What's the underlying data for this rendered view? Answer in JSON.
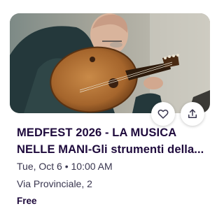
{
  "event": {
    "title_line1": "MEDFEST 2026 - LA MUSICA",
    "title_line2": "NELLE MANI-Gli strumenti della...",
    "date": "Tue, Oct 6 • 10:00 AM",
    "location": "Via Provinciale, 2",
    "price": "Free"
  },
  "actions": {
    "like_icon": "heart-icon",
    "share_icon": "share-upload-icon"
  },
  "colors": {
    "title": "#1e0a3c",
    "meta_text": "#39364f",
    "button_bg": "#ffffff"
  }
}
